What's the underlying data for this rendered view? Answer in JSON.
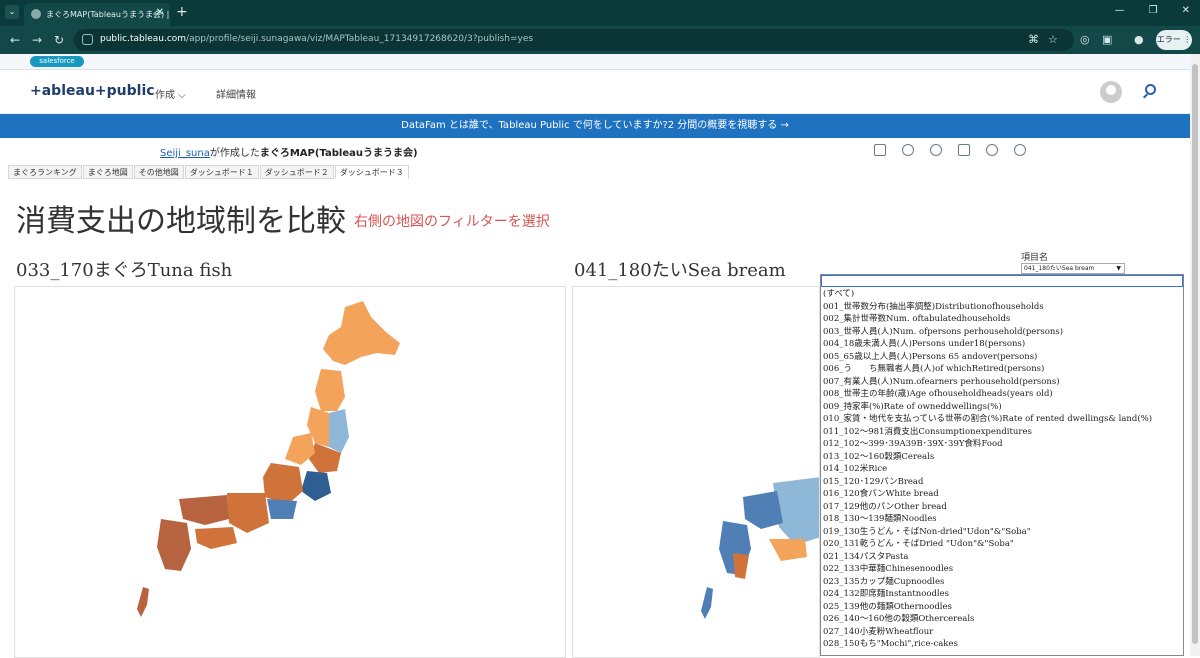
{
  "browser": {
    "tab_title": "まぐろMAP(Tableauうまうま会) | T",
    "url_host": "public.tableau.com",
    "url_path": "/app/profile/seiji.sunagawa/viz/MAPTableau_17134917268620/3?publish=yes",
    "profile_label": "エラー"
  },
  "salesforce": {
    "logo": "salesforce"
  },
  "header": {
    "brand": "+ableau+public",
    "nav_create": "作成 ⌵",
    "nav_info": "詳細情報"
  },
  "banner": {
    "text": "DataFam とは誰で、Tableau Public で何をしていますか?2 分間の概要を視聴する →"
  },
  "viz": {
    "author": "Seiji_suna",
    "author_suffix": "が作成した",
    "title": "まぐろMAP(Tableauうまうま会)"
  },
  "sheet_tabs": [
    "まぐろランキング",
    "まぐろ地図",
    "その他地図",
    "ダッシュボード１",
    "ダッシュボード２",
    "ダッシュボード３"
  ],
  "dashboard": {
    "title": "消費支出の地域制を比較",
    "subtitle": "右側の地図のフィルターを選択",
    "left_map_title": "033_170まぐろTuna fish",
    "right_map_title": "041_180たいSea bream"
  },
  "filter": {
    "label": "項目名",
    "selected": "041_180たいSea bream",
    "options": [
      "(すべて)",
      "001_世帯数分布(抽出率調整)Distributionofhouseholds",
      "002_集計世帯数Num. oftabulatedhouseholds",
      "003_世帯人員(人)Num. ofpersons perhousehold(persons)",
      "004_18歳未満人員(人)Persons under18(persons)",
      "005_65歳以上人員(人)Persons 65 andover(persons)",
      "006_う　　ち無職者人員(人)of whichRetired(persons)",
      "007_有業人員(人)Num.ofearners perhousehold(persons)",
      "008_世帯主の年齢(歳)Age ofhouseholdheads(years old)",
      "009_持家率(%)Rate of owneddwellings(%)",
      "010_家賃・地代を支払っている世帯の割合(%)Rate of rented dwellings& land(%)",
      "011_102～981消費支出Consumptionexpenditures",
      "012_102～399･39A39B･39X･39Y食料Food",
      "013_102～160穀類Cereals",
      "014_102米Rice",
      "015_120･129パンBread",
      "016_120食パンWhite bread",
      "017_129他のパンOther bread",
      "018_130～139麺類Noodles",
      "019_130生うどん・そばNon-dried\"Udon\"&\"Soba\"",
      "020_131乾うどん・そばDried \"Udon\"&\"Soba\"",
      "021_134パスタPasta",
      "022_133中華麺Chinesenoodles",
      "023_135カップ麺Cupnoodles",
      "024_132即席麺Instantnoodles",
      "025_139他の麺類Othernoodles",
      "026_140～160他の穀類Othercereals",
      "027_140小麦粉Wheatflour",
      "028_150もち\"Mochi\",rice-cakes"
    ]
  },
  "colors": {
    "orange": "#f4a35a",
    "dark_orange": "#d0733b",
    "rust": "#b8633f",
    "light_blue": "#8fb7d8",
    "blue": "#4f7fb5",
    "dark_blue": "#2f5e93"
  }
}
